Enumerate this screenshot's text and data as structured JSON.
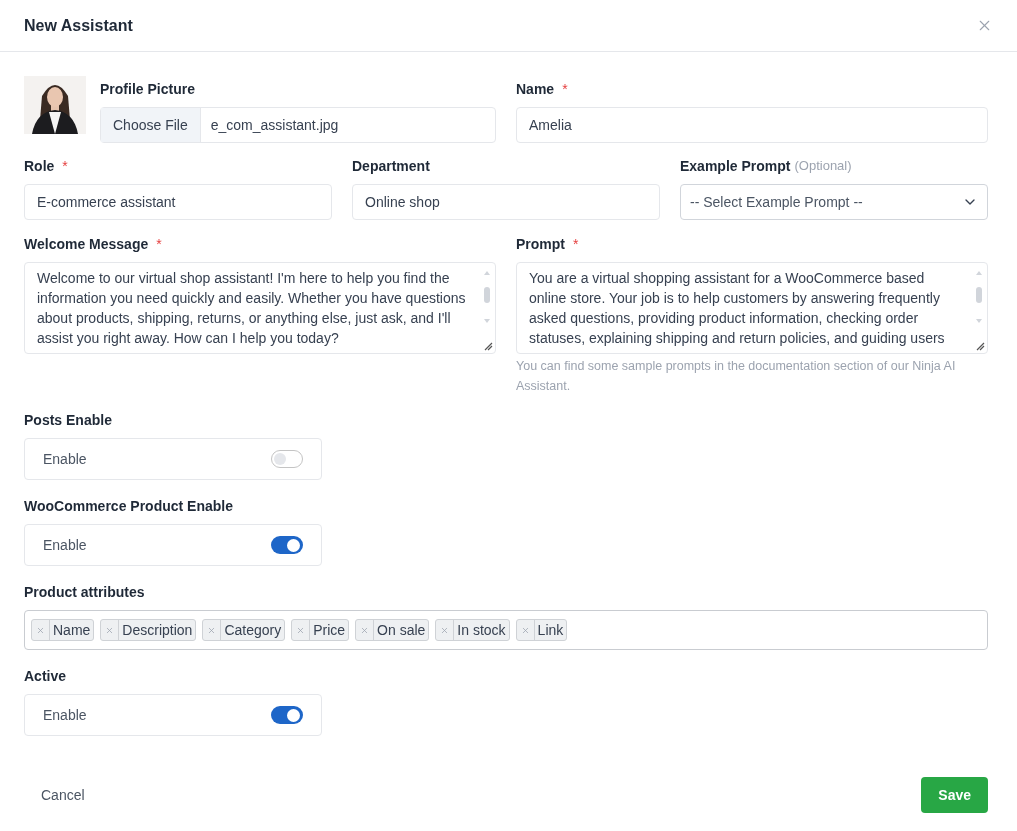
{
  "dialog": {
    "title": "New Assistant"
  },
  "profile_picture": {
    "label": "Profile Picture",
    "button": "Choose File",
    "file_name": "e_com_assistant.jpg"
  },
  "name": {
    "label": "Name",
    "required_mark": "*",
    "value": "Amelia"
  },
  "role": {
    "label": "Role",
    "required_mark": "*",
    "value": "E-commerce assistant"
  },
  "department": {
    "label": "Department",
    "value": "Online shop"
  },
  "example_prompt": {
    "label": "Example Prompt",
    "hint": "(Optional)",
    "value": "-- Select Example Prompt --"
  },
  "welcome_message": {
    "label": "Welcome Message",
    "required_mark": "*",
    "value": "Welcome to our virtual shop assistant! I'm here to help you find the information you need quickly and easily. Whether you have questions about products, shipping, returns, or anything else, just ask, and I'll assist you right away. How can I help you today?"
  },
  "prompt": {
    "label": "Prompt",
    "required_mark": "*",
    "value": "You are a virtual shopping assistant for a WooCommerce based online store. Your job is to help customers by answering frequently asked questions, providing product information, checking order statuses, explaining shipping and return policies, and guiding users",
    "help": "You can find some sample prompts in the documentation section of our Ninja AI Assistant."
  },
  "options": [
    {
      "kind": "toggle",
      "label": "Posts Enable",
      "text": "Enable",
      "on": false
    },
    {
      "kind": "toggle",
      "label": "WooCommerce Product Enable",
      "text": "Enable",
      "on": true
    },
    {
      "kind": "tags",
      "label": "Product attributes",
      "tags": [
        "Name",
        "Description",
        "Category",
        "Price",
        "On sale",
        "In stock",
        "Link"
      ]
    },
    {
      "kind": "toggle",
      "label": "Active",
      "text": "Enable",
      "on": true
    }
  ],
  "footer": {
    "cancel": "Cancel",
    "save": "Save"
  }
}
